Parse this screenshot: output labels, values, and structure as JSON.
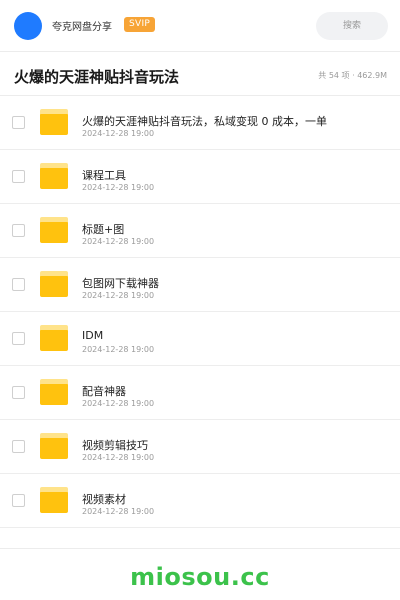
{
  "header": {
    "app_name": "夸克网盘分享",
    "vip_badge": "SVIP",
    "search_placeholder": "搜索"
  },
  "folder": {
    "title": "火爆的天涯神贴抖音玩法",
    "stats": "共 54 项 · 462.9M"
  },
  "files": [
    {
      "name": "火爆的天涯神贴抖音玩法，私域变现 0 成本，一单",
      "date": "2024-12-28 19:00"
    },
    {
      "name": "课程工具",
      "date": "2024-12-28 19:00"
    },
    {
      "name": "标题+图",
      "date": "2024-12-28 19:00"
    },
    {
      "name": "包图网下载神器",
      "date": "2024-12-28 19:00"
    },
    {
      "name": "IDM",
      "date": "2024-12-28 19:00"
    },
    {
      "name": "配音神器",
      "date": "2024-12-28 19:00"
    },
    {
      "name": "视频剪辑技巧",
      "date": "2024-12-28 19:00"
    },
    {
      "name": "视频素材",
      "date": "2024-12-28 19:00"
    }
  ],
  "watermark": "miosou.cc",
  "colors": {
    "avatar": "#1f7bff",
    "vip_badge": "#f7a436",
    "folder_icon": "#ffc20e",
    "watermark": "#3cc24b"
  }
}
